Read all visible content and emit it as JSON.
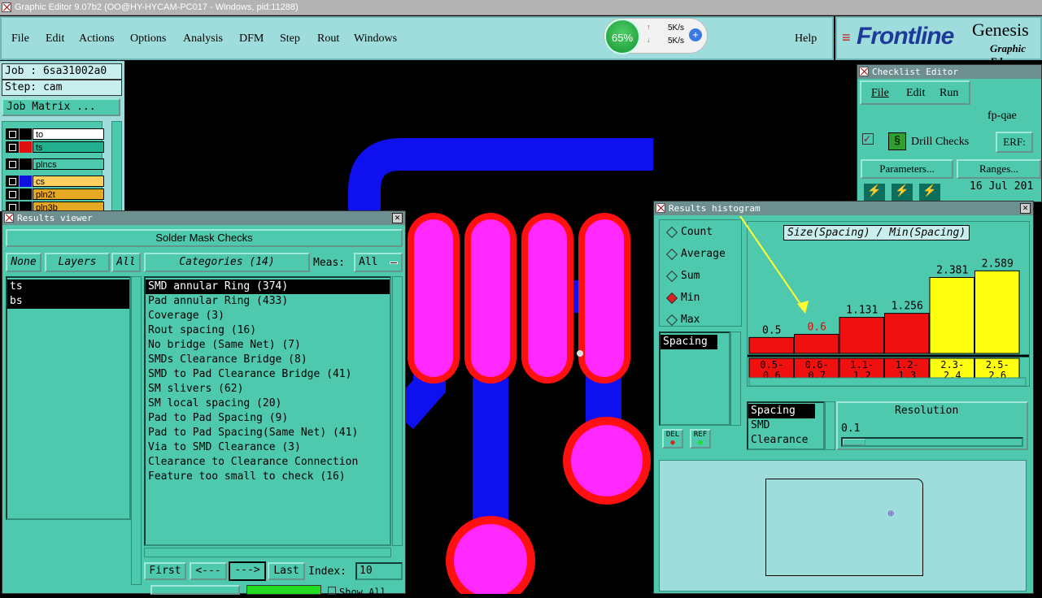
{
  "titlebar": {
    "text": "Graphic Editor 9.07b2 (OO@HY-HYCAM-PC017 - Windows, pid:11288)"
  },
  "menu": {
    "items": [
      "File",
      "Edit",
      "Actions",
      "Options",
      "Analysis",
      "DFM",
      "Step",
      "Rout",
      "Windows"
    ],
    "help": "Help"
  },
  "network": {
    "percent": "65%",
    "up": "5K/s",
    "down": "5K/s"
  },
  "brand": {
    "name": "Frontline",
    "product": "Genesis",
    "sub": "Graphic Ed"
  },
  "job": {
    "job": "Job : 6sa31002a0",
    "step": "Step: cam",
    "matrix_btn": "Job Matrix ..."
  },
  "layers": [
    {
      "name": "to",
      "color": "#000000",
      "bg": "#ffffff"
    },
    {
      "name": "ts",
      "color": "#e01010",
      "bg": "#22b08f"
    },
    {
      "name": "plncs",
      "color": "#000000",
      "bg": "#4ec9ad"
    },
    {
      "name": "cs",
      "color": "#1010e0",
      "bg": "#ffd060"
    },
    {
      "name": "pln2t",
      "color": "#000000",
      "bg": "#e6a820"
    },
    {
      "name": "pln3b",
      "color": "#000000",
      "bg": "#e6a820"
    }
  ],
  "results_viewer": {
    "title": "Results viewer",
    "header": "Solder Mask Checks",
    "none_btn": "None",
    "layers_btn": "Layers",
    "all_btn": "All",
    "layer_list": [
      "ts",
      "bs"
    ],
    "categories_btn": "Categories (14)",
    "meas_label": "Meas:",
    "meas_value": "All",
    "categories": [
      "SMD annular Ring (374)",
      "Pad annular Ring (433)",
      "Coverage (3)",
      "Rout spacing (16)",
      "No bridge (Same Net) (7)",
      "SMDs Clearance Bridge (8)",
      "SMD to Pad Clearance Bridge (41)",
      "SM slivers (62)",
      "SM local spacing (20)",
      "Pad to Pad Spacing (9)",
      "Pad to Pad Spacing(Same Net) (41)",
      "Via to SMD Clearance (3)",
      "Clearance to Clearance Connection",
      "Feature too small to check (16)"
    ],
    "first_btn": "First",
    "prev_btn": "<---",
    "next_btn": "--->",
    "last_btn": "Last",
    "index_label": "Index:",
    "index_value": "10",
    "show_all": "Show All"
  },
  "checklist": {
    "title": "Checklist Editor",
    "menu": [
      "File",
      "Edit",
      "Run"
    ],
    "name": "fp-qae",
    "check": "Drill Checks",
    "erf_btn": "ERF:",
    "params_btn": "Parameters...",
    "ranges_btn": "Ranges...",
    "date": "16 Jul 201"
  },
  "histogram": {
    "title": "Results histogram",
    "modes": [
      "Count",
      "Average",
      "Sum",
      "Min",
      "Max"
    ],
    "selected_mode": "Min",
    "meas_list": [
      "Spacing"
    ],
    "del_btn": "DEL",
    "ref_btn": "REF",
    "list2": [
      "Spacing",
      "SMD",
      "Clearance"
    ],
    "resolution_label": "Resolution",
    "resolution_value": "0.1"
  },
  "chart_data": {
    "type": "bar",
    "title": "Size(Spacing) / Min(Spacing)",
    "categories": [
      "0.5- 0.6",
      "0.6- 0.7",
      "1.1- 1.2",
      "1.2- 1.3",
      "2.3- 2.4",
      "2.5- 2.6"
    ],
    "values": [
      0.5,
      0.6,
      1.131,
      1.256,
      2.381,
      2.589
    ],
    "value_labels": [
      "0.5",
      "0.6",
      "1.131",
      "1.256",
      "2.381",
      "2.589"
    ],
    "colors": [
      "#f01010",
      "#f01010",
      "#f01010",
      "#f01010",
      "#ffff10",
      "#ffff10"
    ],
    "label_colors": [
      "#000000",
      "#d01010",
      "#000000",
      "#000000",
      "#000000",
      "#000000"
    ],
    "ylim": [
      0,
      2.75
    ]
  }
}
